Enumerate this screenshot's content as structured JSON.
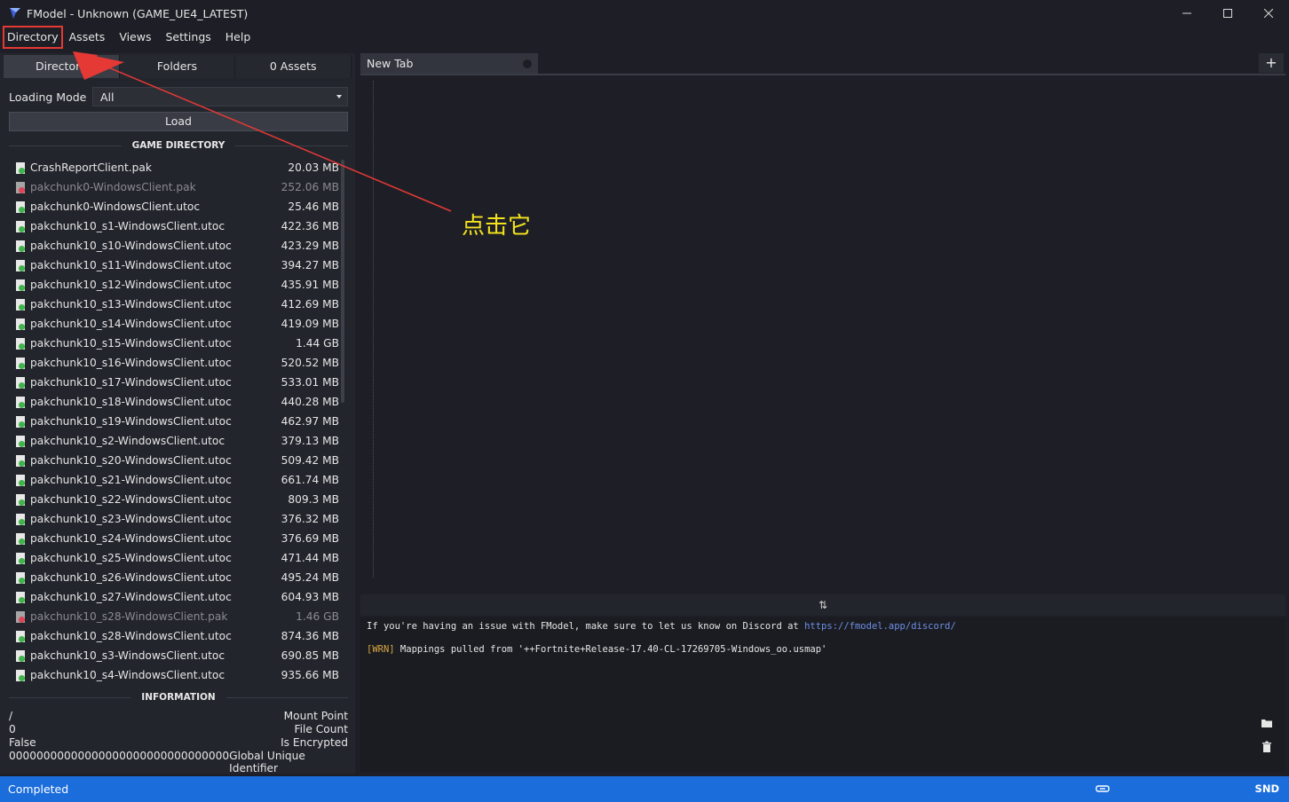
{
  "window": {
    "title": "FModel - Unknown (GAME_UE4_LATEST)",
    "minimize_icon": "minimize-icon",
    "maximize_icon": "maximize-icon",
    "close_icon": "close-icon"
  },
  "menu": {
    "items": [
      "Directory",
      "Assets",
      "Views",
      "Settings",
      "Help"
    ]
  },
  "left_tabs": [
    "Directory",
    "Folders",
    "0 Assets"
  ],
  "loading": {
    "label": "Loading Mode",
    "value": "All",
    "load_button": "Load"
  },
  "game_directory": {
    "header": "GAME DIRECTORY",
    "files": [
      {
        "name": "CrashReportClient.pak",
        "size": "20.03 MB",
        "disabled": false
      },
      {
        "name": "pakchunk0-WindowsClient.pak",
        "size": "252.06 MB",
        "disabled": true
      },
      {
        "name": "pakchunk0-WindowsClient.utoc",
        "size": "25.46 MB",
        "disabled": false
      },
      {
        "name": "pakchunk10_s1-WindowsClient.utoc",
        "size": "422.36 MB",
        "disabled": false
      },
      {
        "name": "pakchunk10_s10-WindowsClient.utoc",
        "size": "423.29 MB",
        "disabled": false
      },
      {
        "name": "pakchunk10_s11-WindowsClient.utoc",
        "size": "394.27 MB",
        "disabled": false
      },
      {
        "name": "pakchunk10_s12-WindowsClient.utoc",
        "size": "435.91 MB",
        "disabled": false
      },
      {
        "name": "pakchunk10_s13-WindowsClient.utoc",
        "size": "412.69 MB",
        "disabled": false
      },
      {
        "name": "pakchunk10_s14-WindowsClient.utoc",
        "size": "419.09 MB",
        "disabled": false
      },
      {
        "name": "pakchunk10_s15-WindowsClient.utoc",
        "size": "1.44 GB",
        "disabled": false
      },
      {
        "name": "pakchunk10_s16-WindowsClient.utoc",
        "size": "520.52 MB",
        "disabled": false
      },
      {
        "name": "pakchunk10_s17-WindowsClient.utoc",
        "size": "533.01 MB",
        "disabled": false
      },
      {
        "name": "pakchunk10_s18-WindowsClient.utoc",
        "size": "440.28 MB",
        "disabled": false
      },
      {
        "name": "pakchunk10_s19-WindowsClient.utoc",
        "size": "462.97 MB",
        "disabled": false
      },
      {
        "name": "pakchunk10_s2-WindowsClient.utoc",
        "size": "379.13 MB",
        "disabled": false
      },
      {
        "name": "pakchunk10_s20-WindowsClient.utoc",
        "size": "509.42 MB",
        "disabled": false
      },
      {
        "name": "pakchunk10_s21-WindowsClient.utoc",
        "size": "661.74 MB",
        "disabled": false
      },
      {
        "name": "pakchunk10_s22-WindowsClient.utoc",
        "size": "809.3 MB",
        "disabled": false
      },
      {
        "name": "pakchunk10_s23-WindowsClient.utoc",
        "size": "376.32 MB",
        "disabled": false
      },
      {
        "name": "pakchunk10_s24-WindowsClient.utoc",
        "size": "376.69 MB",
        "disabled": false
      },
      {
        "name": "pakchunk10_s25-WindowsClient.utoc",
        "size": "471.44 MB",
        "disabled": false
      },
      {
        "name": "pakchunk10_s26-WindowsClient.utoc",
        "size": "495.24 MB",
        "disabled": false
      },
      {
        "name": "pakchunk10_s27-WindowsClient.utoc",
        "size": "604.93 MB",
        "disabled": false
      },
      {
        "name": "pakchunk10_s28-WindowsClient.pak",
        "size": "1.46 GB",
        "disabled": true
      },
      {
        "name": "pakchunk10_s28-WindowsClient.utoc",
        "size": "874.36 MB",
        "disabled": false
      },
      {
        "name": "pakchunk10_s3-WindowsClient.utoc",
        "size": "690.85 MB",
        "disabled": false
      },
      {
        "name": "pakchunk10_s4-WindowsClient.utoc",
        "size": "935.66 MB",
        "disabled": false
      }
    ]
  },
  "information": {
    "header": "INFORMATION",
    "rows": [
      {
        "value": "/",
        "label": "Mount Point"
      },
      {
        "value": "0",
        "label": "File Count"
      },
      {
        "value": "False",
        "label": "Is Encrypted"
      },
      {
        "value": "00000000000000000000000000000000",
        "label": "Global Unique Identifier"
      }
    ]
  },
  "editor": {
    "tab_label": "New Tab",
    "add_tab": "+"
  },
  "splitter_icon": "⇅",
  "console": {
    "line1_text": "If you're having an issue with FModel, make sure to let us know on Discord at ",
    "line1_link": "https://fmodel.app/discord/",
    "line2_tag": "[WRN]",
    "line2_text": " Mappings pulled from '++Fortnite+Release-17.40-CL-17269705-Windows_oo.usmap'"
  },
  "status": {
    "text": "Completed",
    "snd": "SND",
    "link_icon": "link-icon"
  },
  "annotation": {
    "text": "点击它",
    "color": "#f3e31d",
    "arrow_color": "#e53935"
  },
  "colors": {
    "background": "#1e1f26",
    "panel": "#23252d",
    "statusbar": "#1b6ddb",
    "link": "#6d8fe6",
    "warn": "#d9a640"
  }
}
